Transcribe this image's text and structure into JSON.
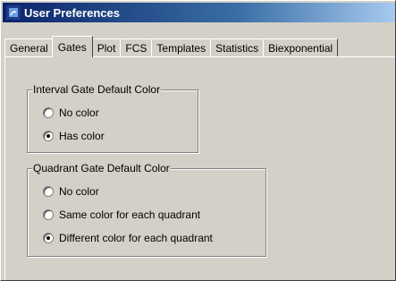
{
  "window": {
    "title": "User Preferences",
    "title_icon": "java-app-icon",
    "titlebar_color": "#0a246a"
  },
  "tabs": [
    {
      "label": "General",
      "selected": false
    },
    {
      "label": "Gates",
      "selected": true
    },
    {
      "label": "Plot",
      "selected": false
    },
    {
      "label": "FCS",
      "selected": false
    },
    {
      "label": "Templates",
      "selected": false
    },
    {
      "label": "Statistics",
      "selected": false
    },
    {
      "label": "Biexponential",
      "selected": false
    }
  ],
  "interval_group": {
    "legend": "Interval Gate Default Color",
    "options": [
      {
        "label": "No color",
        "checked": false
      },
      {
        "label": "Has color",
        "checked": true
      }
    ]
  },
  "quadrant_group": {
    "legend": "Quadrant Gate Default Color",
    "options": [
      {
        "label": "No color",
        "checked": false
      },
      {
        "label": "Same color for each quadrant",
        "checked": false
      },
      {
        "label": "Different color for each quadrant",
        "checked": true
      }
    ]
  }
}
